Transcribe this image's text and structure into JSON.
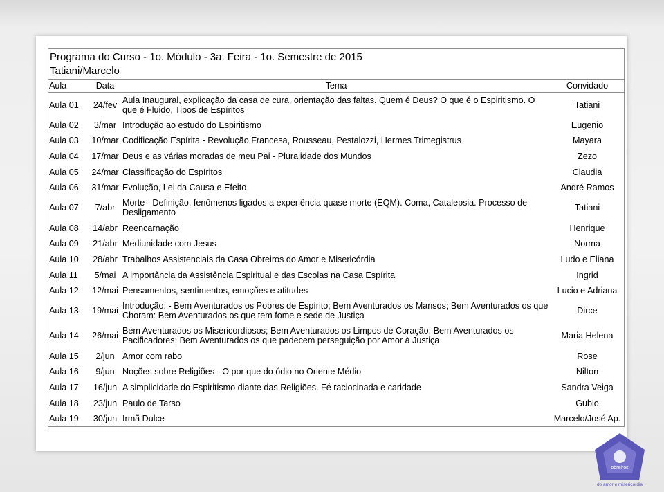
{
  "header": {
    "line1": "Programa do Curso  - 1o. Módulo - 3a. Feira - 1o. Semestre de 2015",
    "line2": "Tatiani/Marcelo"
  },
  "columns": {
    "aula": "Aula",
    "data": "Data",
    "tema": "Tema",
    "convidado": "Convidado"
  },
  "rows": [
    {
      "aula": "Aula 01",
      "data": "24/fev",
      "tema": "Aula Inaugural, explicação da casa de cura, orientação das faltas. Quem é Deus? O que é o Espiritismo. O que é Fluido, Tipos de Espíritos",
      "convidado": "Tatiani",
      "tall": true
    },
    {
      "aula": "Aula 02",
      "data": "3/mar",
      "tema": "Introdução ao estudo do Espiritismo",
      "convidado": "Eugenio"
    },
    {
      "aula": "Aula 03",
      "data": "10/mar",
      "tema": "Codificação Espírita - Revolução Francesa, Rousseau, Pestalozzi, Hermes Trimegistrus",
      "convidado": "Mayara"
    },
    {
      "aula": "Aula 04",
      "data": "17/mar",
      "tema": "Deus e as várias moradas de meu Pai - Pluralidade dos Mundos",
      "convidado": "Zezo"
    },
    {
      "aula": "Aula 05",
      "data": "24/mar",
      "tema": "Classificação do Espíritos",
      "convidado": "Claudia"
    },
    {
      "aula": "Aula 06",
      "data": "31/mar",
      "tema": "Evolução, Lei da Causa e Efeito",
      "convidado": "André Ramos"
    },
    {
      "aula": "Aula 07",
      "data": "7/abr",
      "tema": "Morte - Definição, fenômenos ligados a experiência quase morte (EQM). Coma, Catalepsia. Processo de Desligamento",
      "convidado": "Tatiani",
      "tall": true
    },
    {
      "aula": "Aula 08",
      "data": "14/abr",
      "tema": "Reencarnação",
      "convidado": "Henrique"
    },
    {
      "aula": "Aula 09",
      "data": "21/abr",
      "tema": "Mediunidade com Jesus",
      "convidado": "Norma"
    },
    {
      "aula": "Aula 10",
      "data": "28/abr",
      "tema": "Trabalhos Assistenciais da Casa Obreiros do Amor e Misericórdia",
      "convidado": "Ludo e Eliana"
    },
    {
      "aula": "Aula 11",
      "data": "5/mai",
      "tema": "A importância da Assistência Espiritual e das Escolas na Casa Espírita",
      "convidado": "Ingrid"
    },
    {
      "aula": "Aula 12",
      "data": "12/mai",
      "tema": "Pensamentos, sentimentos, emoções e atitudes",
      "convidado": "Lucio e Adriana"
    },
    {
      "aula": "Aula 13",
      "data": "19/mai",
      "tema": "Introdução: - Bem Aventurados os Pobres de Espírito; Bem Aventurados os Mansos; Bem Aventurados os que Choram: Bem Aventurados os que tem fome e sede de Justiça",
      "convidado": "Dirce",
      "tall": true
    },
    {
      "aula": "Aula 14",
      "data": "26/mai",
      "tema": "Bem Aventurados os Misericordiosos; Bem Aventurados os Limpos de Coração; Bem Aventurados os Pacificadores; Bem Aventurados os que padecem perseguição por Amor à Justiça",
      "convidado": "Maria Helena",
      "tall": true
    },
    {
      "aula": "Aula 15",
      "data": "2/jun",
      "tema": "Amor com rabo",
      "convidado": "Rose"
    },
    {
      "aula": "Aula 16",
      "data": "9/jun",
      "tema": "Noções sobre Religiões - O por que do ódio no Oriente Médio",
      "convidado": "Nilton"
    },
    {
      "aula": "Aula 17",
      "data": "16/jun",
      "tema": "A simplicidade do Espiritismo diante das Religiões.  Fé raciocinada e caridade",
      "convidado": "Sandra Veiga"
    },
    {
      "aula": "Aula 18",
      "data": "23/jun",
      "tema": "Paulo de Tarso",
      "convidado": "Gubio"
    },
    {
      "aula": "Aula 19",
      "data": "30/jun",
      "tema": "Irmã Dulce",
      "convidado": "Marcelo/José Ap."
    }
  ],
  "logo": {
    "text_top": "obreiros",
    "text_bottom": "do amor e misericórdia",
    "color": "#5b57b8"
  }
}
